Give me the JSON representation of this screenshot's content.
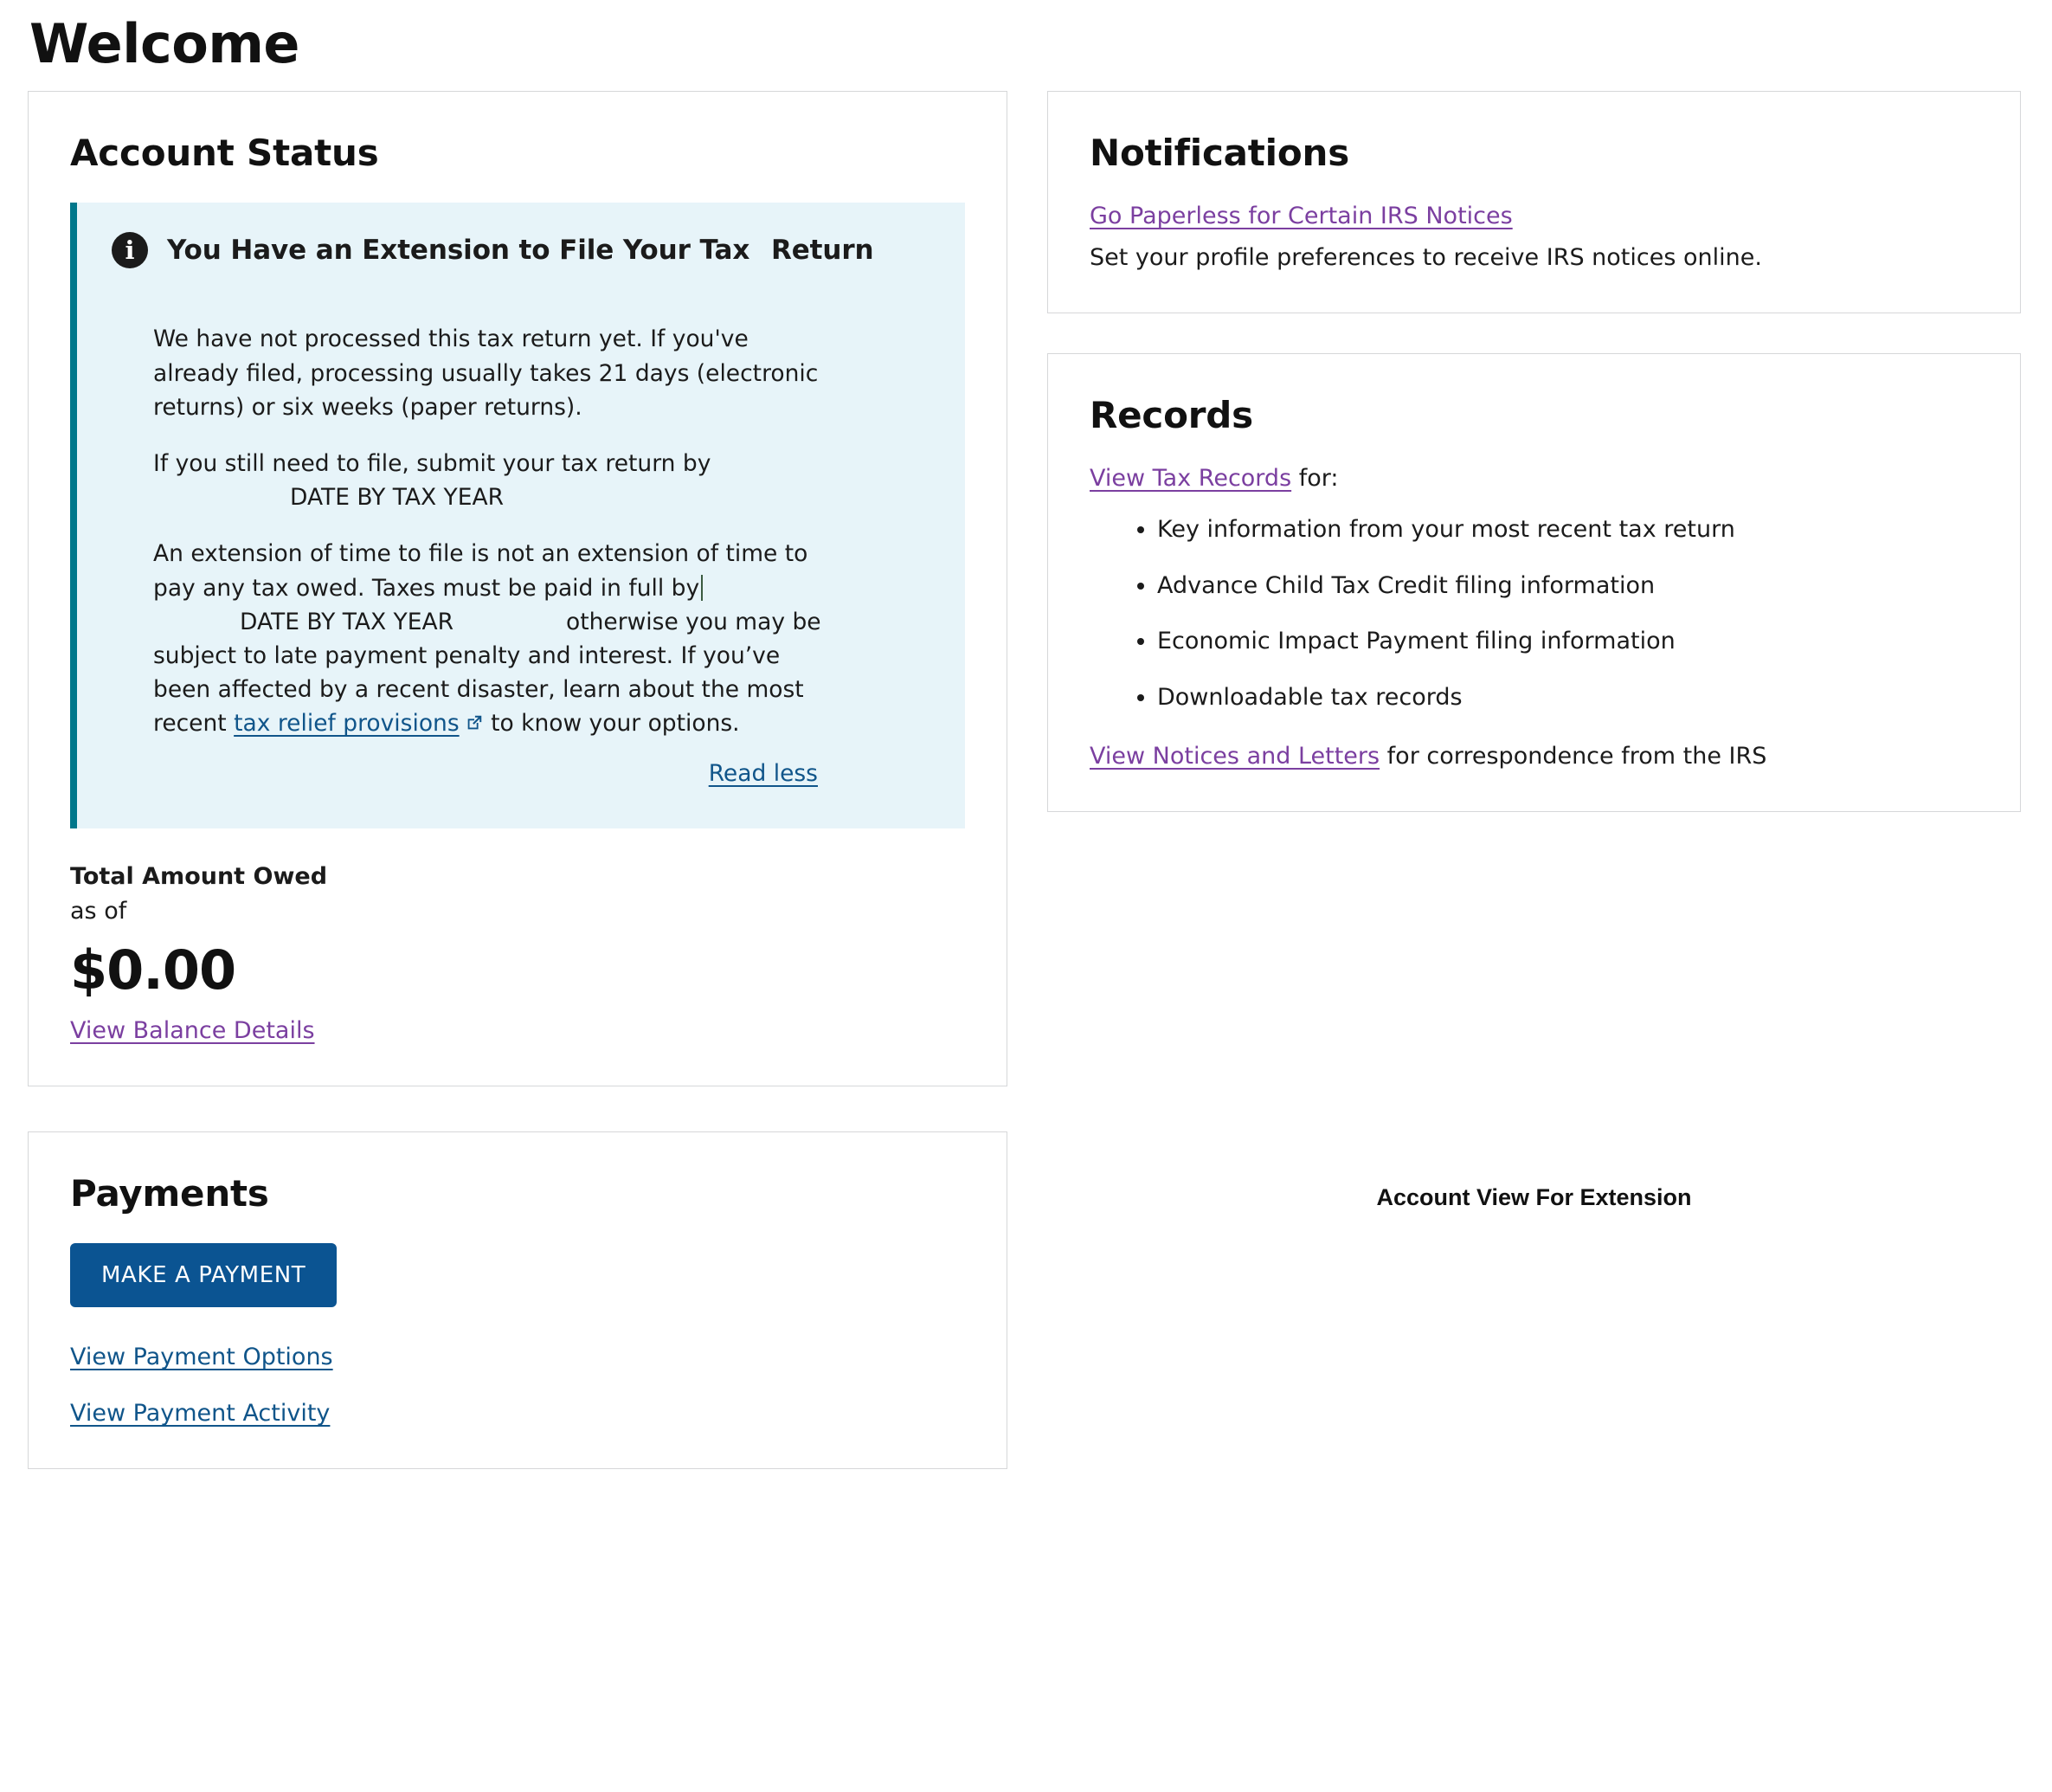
{
  "page": {
    "title": "Welcome"
  },
  "account_status": {
    "heading": "Account Status",
    "alert": {
      "icon": "info-circle-icon",
      "title_part1": "You Have an Extension to File Your Tax",
      "title_part2": "Return",
      "paragraph1": "We have not processed this tax return yet. If you've already filed, processing usually takes 21 days (electronic returns) or six weeks (paper returns).",
      "paragraph2_lead": "If you still need to file, submit your tax return by",
      "paragraph2_placeholder": "DATE BY TAX YEAR",
      "paragraph3_lead": "An extension of time to file is not an extension of time to pay any tax owed. Taxes must be paid in full by",
      "paragraph3_placeholder": "DATE BY TAX YEAR",
      "paragraph3_mid": "otherwise you may be subject to late payment penalty and interest. If you’ve been affected by a recent disaster, learn about the most recent",
      "link_text": "tax relief provisions",
      "link_icon": "external-link-icon",
      "paragraph3_tail": "to know your options.",
      "read_less": "Read less",
      "accent_color": "#00778b",
      "background_color": "#e7f4f9"
    },
    "balance": {
      "label": "Total Amount Owed",
      "as_of": "as of",
      "amount": "$0.00",
      "link": "View Balance Details"
    }
  },
  "payments": {
    "heading": "Payments",
    "make_payment_button": "MAKE A PAYMENT",
    "links": [
      "View Payment Options",
      "View Payment Activity"
    ],
    "button_color": "#0b5492"
  },
  "notifications": {
    "heading": "Notifications",
    "link": "Go Paperless for Certain IRS Notices",
    "description": "Set your profile preferences to receive IRS notices online."
  },
  "records": {
    "heading": "Records",
    "link": "View Tax Records",
    "intro_suffix": "for:",
    "items": [
      "Key information from your most recent tax return",
      "Advance Child Tax Credit filing information",
      "Economic Impact Payment filing information",
      "Downloadable tax records"
    ],
    "footer_link": "View Notices and Letters",
    "footer_suffix": "for correspondence from the IRS"
  },
  "caption": "Account View For Extension",
  "colors": {
    "link_blue": "#10558a",
    "link_purple": "#7b3fa0",
    "card_border": "#d6d7d9"
  }
}
